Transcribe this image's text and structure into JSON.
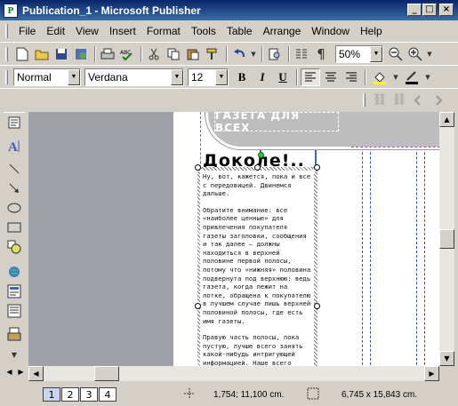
{
  "window": {
    "title": "Publication_1 - Microsoft Publisher",
    "app_icon": "P",
    "minimize": "_",
    "maximize": "□",
    "close": "×"
  },
  "menu": [
    "File",
    "Edit",
    "View",
    "Insert",
    "Format",
    "Tools",
    "Table",
    "Arrange",
    "Window",
    "Help"
  ],
  "standard_toolbar": {
    "zoom_value": "50%"
  },
  "format_toolbar": {
    "style_value": "Normal",
    "font_value": "Verdana",
    "size_value": "12",
    "bold": "B",
    "italic": "I",
    "underline": "U"
  },
  "document": {
    "banner_text": "ГАЗЕТА ДЛЯ ВСЕХ",
    "headline": "Доколе!..",
    "body_paragraphs": [
      "Ну, вот, кажется, пока и все с передовицей. Двинемся дальше.",
      "Обратите внимание: все «наиболее ценные» для привлечения покупателя газеты заголовки, сообщения и так далее — должны находиться в верхней половине первой полосы, потому что «нижняя» половина подвернута под верхнюю: ведь газета, когда лежит на лотке, обращена к покупателю в лучшем случае лишь верхней половиной полосы, где есть имя газеты.",
      "Правую часть полосы, пока пустую, лучше всего занять какой-нибудь интригующей информацией. Наше всего"
    ]
  },
  "statusbar": {
    "pages": [
      "1",
      "2",
      "3",
      "4"
    ],
    "active_page": "1",
    "position": "1,754; 11,100 cm.",
    "size": "6,745 x 15,843 cm."
  }
}
